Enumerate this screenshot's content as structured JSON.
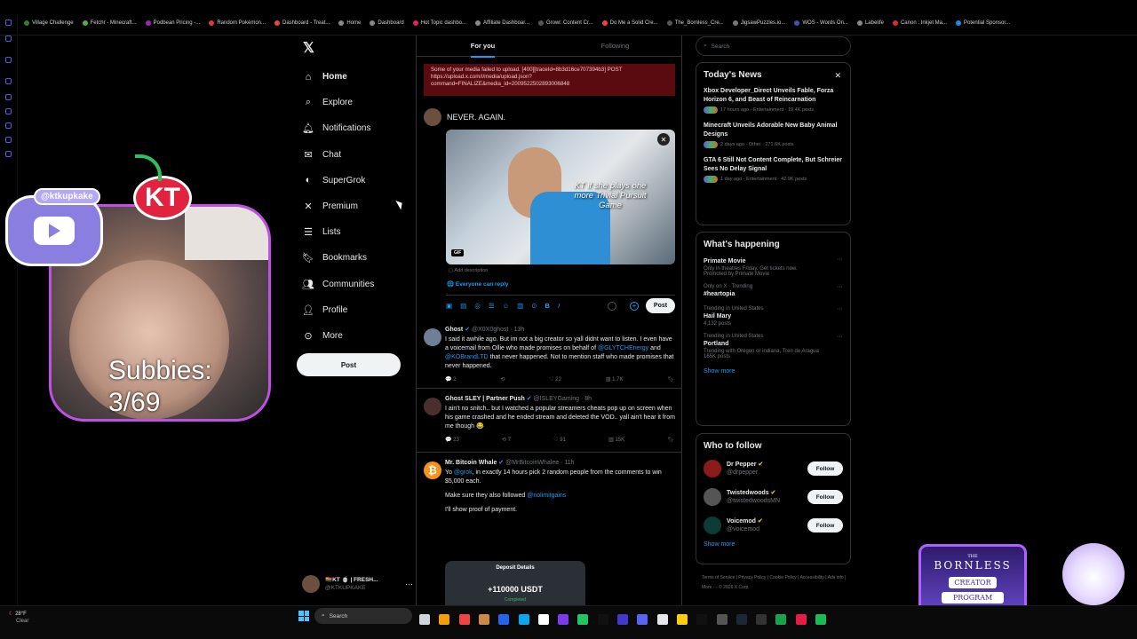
{
  "bookmarks": [
    "Village Challenge",
    "Fetchr - Minecraft...",
    "Podbean Pricing -...",
    "Random Pokémon...",
    "Dashboard - Treat...",
    "Home",
    "Dashboard",
    "Hot Topic dashbo...",
    "Affiliate Dashboar...",
    "Growi: Content Cr...",
    "Do Me a Solid Cre...",
    "The_Bornless_Cre...",
    "JigsawPuzzles.io...",
    "WOS - Words On...",
    "Labelife",
    "Canon : Inkjet Ma...",
    "Potential Sponsor..."
  ],
  "overlay": {
    "handle": "@ktkupkake",
    "initials": "KT",
    "subs_label": "Subbies:",
    "subs_count": "3/69"
  },
  "nav": {
    "items": [
      {
        "label": "Home",
        "icon": "home-icon"
      },
      {
        "label": "Explore",
        "icon": "search-icon"
      },
      {
        "label": "Notifications",
        "icon": "bell-icon"
      },
      {
        "label": "Chat",
        "icon": "mail-icon"
      },
      {
        "label": "SuperGrok",
        "icon": "grok-icon"
      },
      {
        "label": "Premium",
        "icon": "x-icon"
      },
      {
        "label": "Lists",
        "icon": "list-icon"
      },
      {
        "label": "Bookmarks",
        "icon": "bookmark-icon"
      },
      {
        "label": "Communities",
        "icon": "people-icon"
      },
      {
        "label": "Profile",
        "icon": "person-icon"
      },
      {
        "label": "More",
        "icon": "more-icon"
      }
    ],
    "post_label": "Post"
  },
  "profile": {
    "name": "🏳️‍🌈KT 🍵 | FRESH...",
    "handle": "@KTKUPKAKE"
  },
  "feed": {
    "tabs": [
      "For you",
      "Following"
    ],
    "error": "Some of your media failed to upload. [400][traceId=8b3d16ce707394b3] POST https://upload.x.com/i/media/upload.json?command=FINALIZE&media_id=2009522502893006848",
    "compose": {
      "text": "NEVER. AGAIN.",
      "gif_caption": "KT if she plays one more Trivial Pursuit Game",
      "gif_badge": "GIF",
      "add_description": "Add description",
      "reply_setting": "Everyone can reply",
      "post_label": "Post"
    },
    "tweets": [
      {
        "name": "Ghost",
        "handle": "@X0X0ghost · 13h",
        "text_a": "I said it awhile ago. But im not a big creator so yall didnt want to listen. I even have a voicemail from Ollie who made promises on behalf of",
        "link_a": "@GLYTCHEnergy",
        "text_b": "and",
        "link_b": "@KOBrandLTD",
        "text_c": "that never happened. Not to mention staff who made promises that never happened.",
        "replies": "2",
        "retweets": "",
        "likes": "22",
        "views": "1.7K"
      },
      {
        "name": "Ghost SLEY | Partner Push",
        "handle": "@ISLEYGaming · 8h",
        "text_a": "I ain't no snitch.. but I watched a popular streamers cheats pop up on screen when his game crashed and he ended stream and deleted the VOD.. yall ain't hear it from me though 😂",
        "replies": "23",
        "retweets": "7",
        "likes": "91",
        "views": "15K"
      },
      {
        "name": "Mr. Bitcoin Whale",
        "handle": "@MrBitcoinWhalee · 11h",
        "text_a": "Yo",
        "link_a": "@grok",
        "text_b": ", in exactly 14 hours pick 2 random people from the comments to win $5,000 each.",
        "text_c": "Make sure they also followed",
        "link_c": "@nolimitgains",
        "text_d": "I'll show proof of payment.",
        "card_title": "Deposit Details",
        "card_amount": "+110000 USDT",
        "card_status": "Completed"
      }
    ]
  },
  "right": {
    "search_placeholder": "Search",
    "news_title": "Today's News",
    "news": [
      {
        "title": "Xbox Developer_Direct Unveils Fable, Forza Horizon 6, and Beast of Reincarnation",
        "meta": "17 hours ago · Entertainment · 19.4K posts"
      },
      {
        "title": "Minecraft Unveils Adorable New Baby Animal Designs",
        "meta": "2 days ago · Other · 271.6K posts"
      },
      {
        "title": "GTA 6 Still Not Content Complete, But Schreier Sees No Delay Signal",
        "meta": "1 day ago · Entertainment · 42.9K posts"
      }
    ],
    "happening_title": "What's happening",
    "trends": [
      {
        "context": "",
        "title": "Primate Movie",
        "sub": "Only in theatres Friday. Get tickets now.",
        "extra": "Promoted by Primate Movie"
      },
      {
        "context": "Only on X · Trending",
        "title": "#heartopia",
        "sub": "",
        "extra": ""
      },
      {
        "context": "Trending in United States",
        "title": "Hail Mary",
        "sub": "4,132 posts",
        "extra": ""
      },
      {
        "context": "Trending in United States",
        "title": "Portland",
        "sub": "Trending with Oregon or indiana, Tren de Aragua",
        "extra": "165K posts"
      }
    ],
    "show_more": "Show more",
    "follow_title": "Who to follow",
    "follow": [
      {
        "name": "Dr Pepper",
        "handle": "@drpepper",
        "color": "#8b1a1a"
      },
      {
        "name": "Twistedwoods",
        "handle": "@twistedwoodsMN",
        "color": "#555"
      },
      {
        "name": "Voicemod",
        "handle": "@voicemod",
        "color": "#0d3b35"
      }
    ],
    "follow_label": "Follow",
    "footer": "Terms of Service | Privacy Policy | Cookie Policy | Accessibility | Ads info | More ··· © 2026 X Corp."
  },
  "taskbar": {
    "weather_temp": "28°F",
    "weather_desc": "Clear",
    "search": "Search"
  },
  "brand": {
    "the": "THE",
    "bornless": "BORNLESS",
    "creator": "CREATOR",
    "program": "PROGRAM"
  }
}
